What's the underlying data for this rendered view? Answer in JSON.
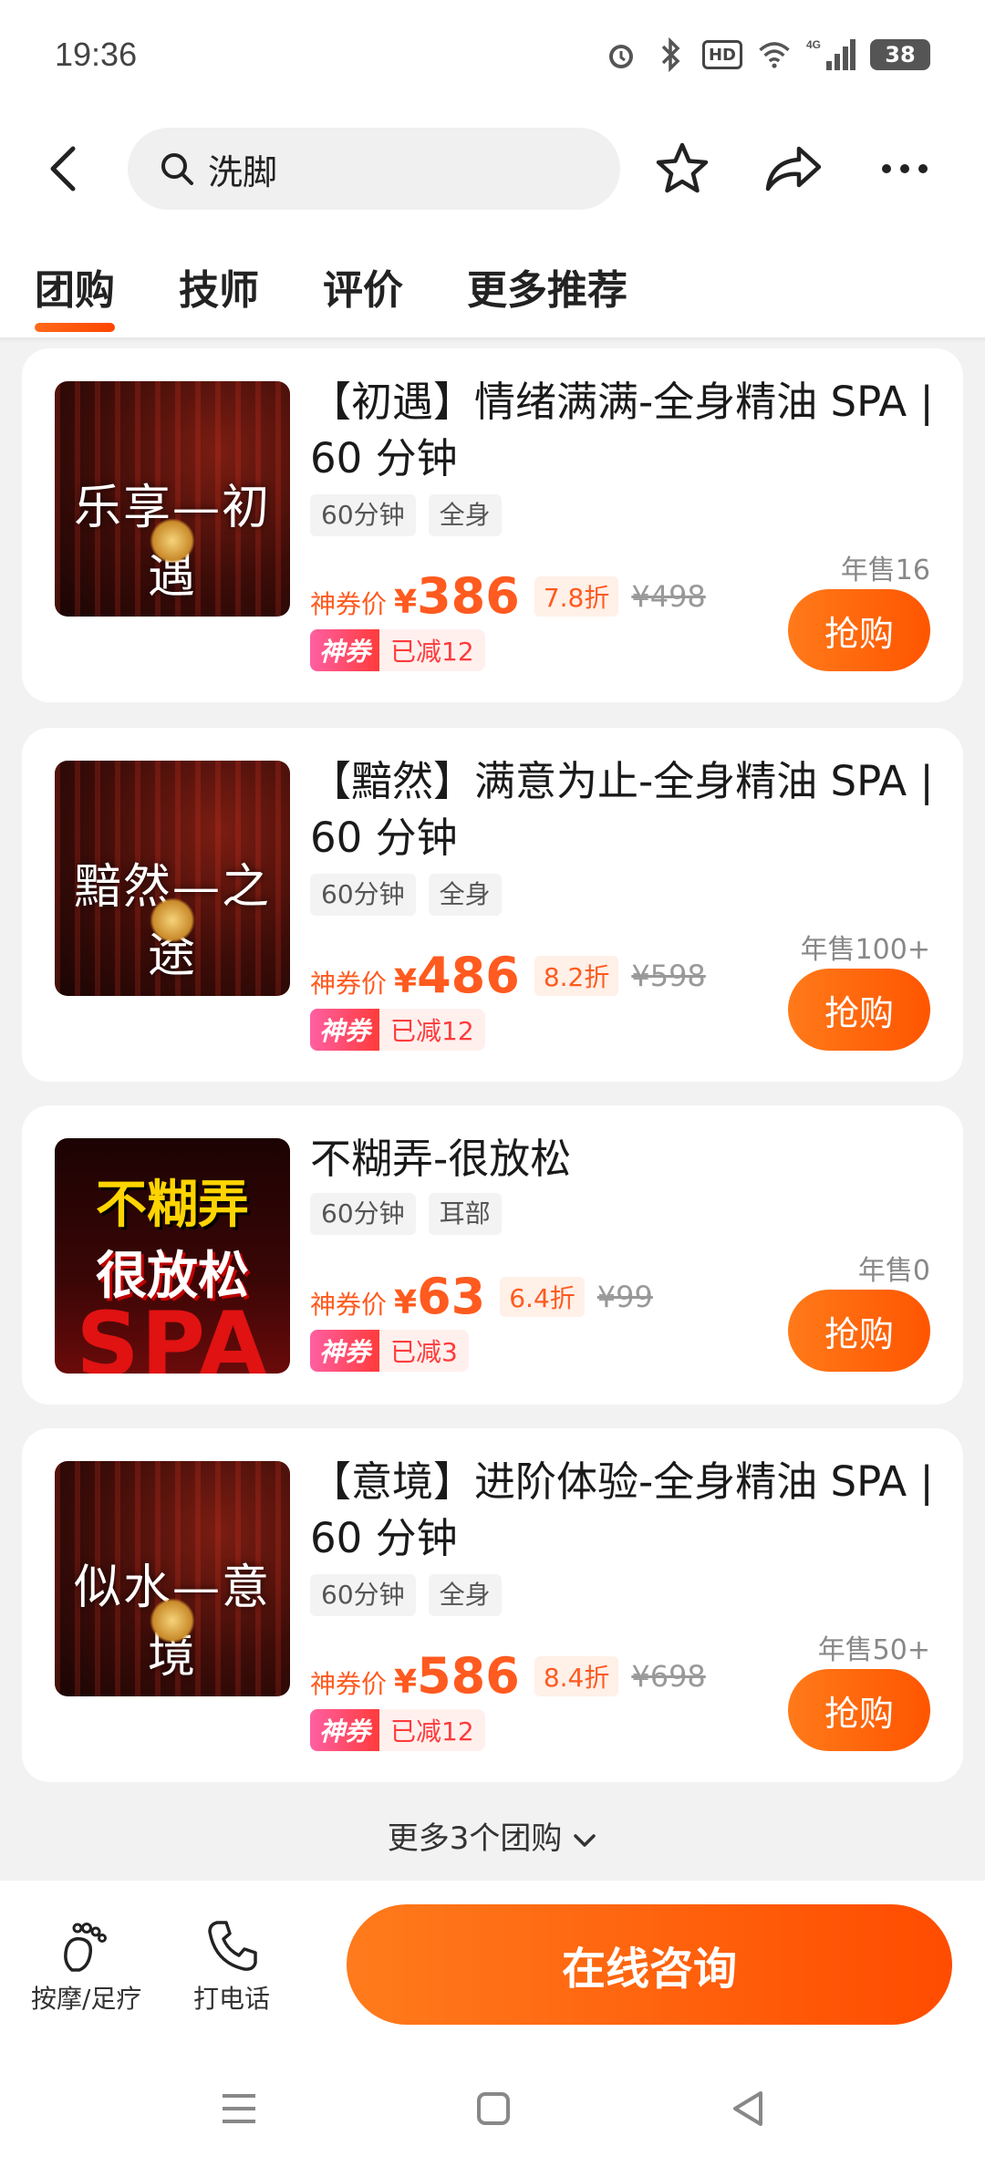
{
  "status_bar": {
    "time": "19:36",
    "hd": "HD",
    "network": "4G",
    "battery": "38"
  },
  "search": {
    "query": "洗脚"
  },
  "tabs": [
    {
      "label": "团购",
      "active": true
    },
    {
      "label": "技师",
      "active": false
    },
    {
      "label": "评价",
      "active": false
    },
    {
      "label": "更多推荐",
      "active": false
    }
  ],
  "deals": [
    {
      "thumb_text": "乐享—初遇",
      "title": "【初遇】情绪满满-全身精油 SPA | 60 分钟",
      "tags": [
        "60分钟",
        "全身"
      ],
      "price_label": "神券价",
      "currency": "¥",
      "price": "386",
      "discount": "7.8折",
      "original_price": "¥498",
      "coupon_badge": "神券",
      "coupon_text": "已减12",
      "sales": "年售16",
      "buy_label": "抢购"
    },
    {
      "thumb_text": "黯然—之途",
      "title": "【黯然】满意为止-全身精油 SPA | 60 分钟",
      "tags": [
        "60分钟",
        "全身"
      ],
      "price_label": "神券价",
      "currency": "¥",
      "price": "486",
      "discount": "8.2折",
      "original_price": "¥598",
      "coupon_badge": "神券",
      "coupon_text": "已减12",
      "sales": "年售100+",
      "buy_label": "抢购"
    },
    {
      "thumb_lines": [
        "不糊弄",
        "很放松",
        "SPA"
      ],
      "title": "不糊弄-很放松",
      "tags": [
        "60分钟",
        "耳部"
      ],
      "price_label": "神券价",
      "currency": "¥",
      "price": "63",
      "discount": "6.4折",
      "original_price": "¥99",
      "coupon_badge": "神券",
      "coupon_text": "已减3",
      "sales": "年售0",
      "buy_label": "抢购"
    },
    {
      "thumb_text": "似水—意境",
      "title": "【意境】进阶体验-全身精油 SPA | 60 分钟",
      "tags": [
        "60分钟",
        "全身"
      ],
      "price_label": "神券价",
      "currency": "¥",
      "price": "586",
      "discount": "8.4折",
      "original_price": "¥698",
      "coupon_badge": "神券",
      "coupon_text": "已减12",
      "sales": "年售50+",
      "buy_label": "抢购"
    }
  ],
  "more_deals": "更多3个团购",
  "bottom_bar": {
    "category_label": "按摩/足疗",
    "call_label": "打电话",
    "consult_label": "在线咨询"
  },
  "colors": {
    "accent": "#ff5a1f",
    "button_gradient_start": "#ff7a1a",
    "button_gradient_end": "#ff5500",
    "coupon_pink": "#ff5fa2"
  }
}
